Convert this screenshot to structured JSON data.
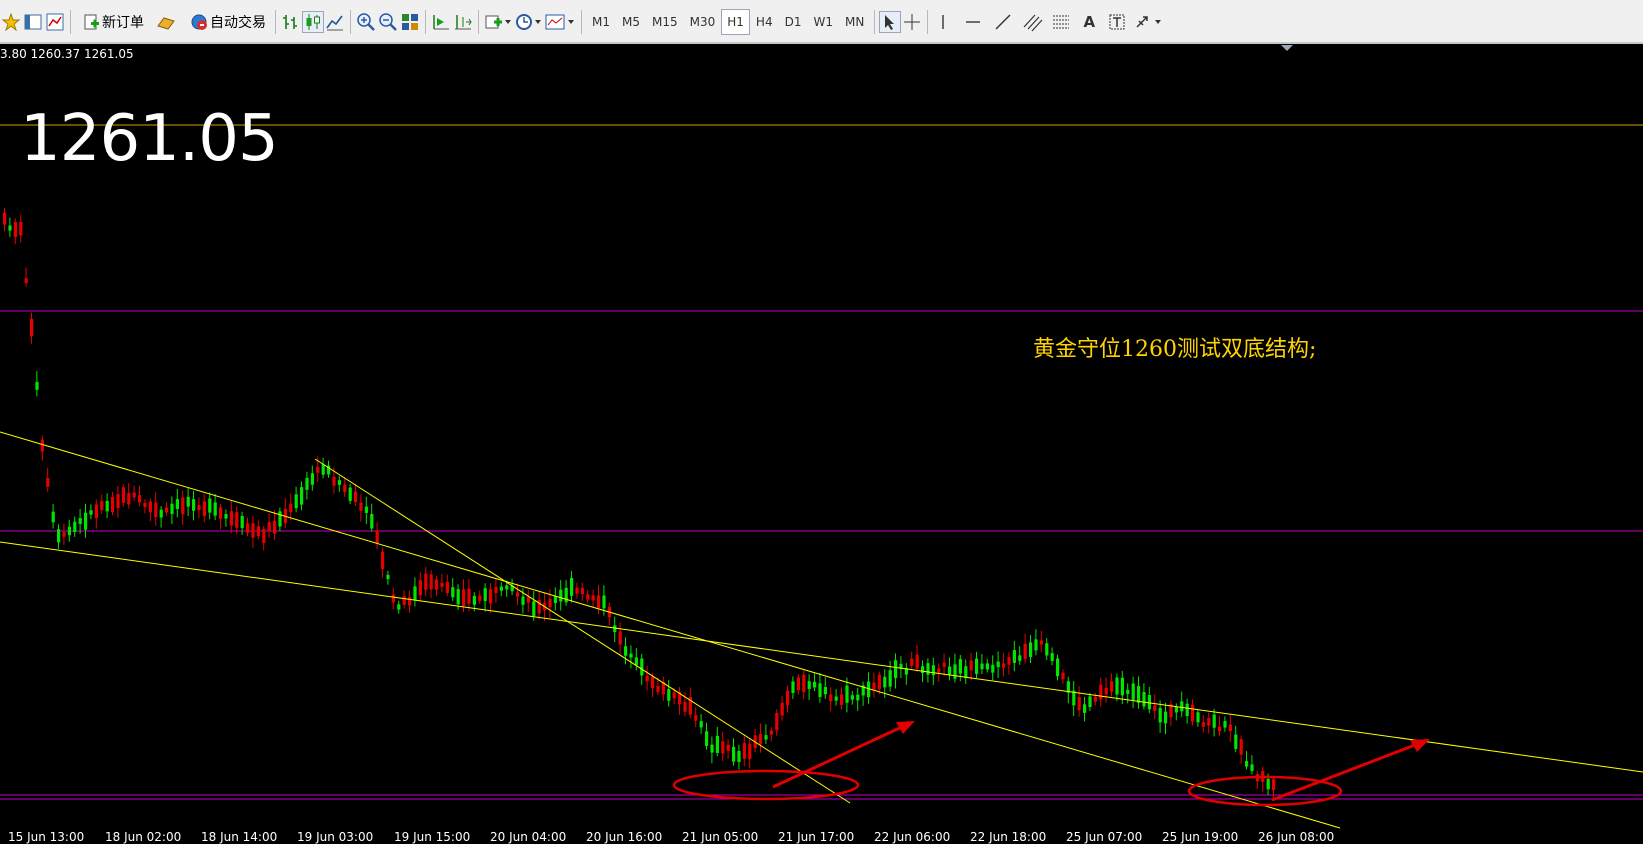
{
  "toolbar": {
    "new_order_label": "新订单",
    "auto_trade_label": "自动交易",
    "timeframes": [
      "M1",
      "M5",
      "M15",
      "M30",
      "H1",
      "H4",
      "D1",
      "W1",
      "MN"
    ],
    "active_timeframe": "H1",
    "text_tool_label": "A"
  },
  "chart": {
    "ohlc_text": "3.80 1260.37 1261.05",
    "current_price": "1261.05",
    "annotation": "黄金守位1260测试双底结构;",
    "x_labels": [
      "15 Jun 13:00",
      "18 Jun 02:00",
      "18 Jun 14:00",
      "19 Jun 03:00",
      "19 Jun 15:00",
      "20 Jun 04:00",
      "20 Jun 16:00",
      "21 Jun 05:00",
      "21 Jun 17:00",
      "22 Jun 06:00",
      "22 Jun 18:00",
      "25 Jun 07:00",
      "25 Jun 19:00",
      "26 Jun 08:00"
    ],
    "colors": {
      "background": "#000000",
      "bull_candle": "#00e600",
      "bear_candle": "#e60000",
      "trendline": "#ffff00",
      "price_level_line": "#d4a000",
      "horizontal_levels": "#c000c0",
      "marker": "#e00000",
      "annotation_text": "#ffd400"
    }
  }
}
